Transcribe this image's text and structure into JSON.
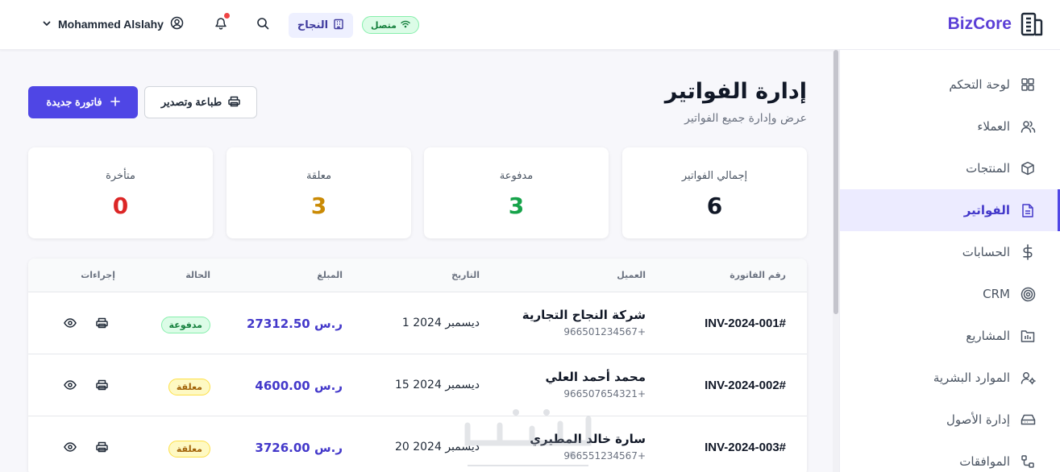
{
  "header": {
    "brand_name": "BizCore",
    "status_label": "متصل",
    "company_label": "النجاح",
    "user_name": "Mohammed Alslahy"
  },
  "sidebar": {
    "items": [
      {
        "label": "لوحة التحكم",
        "icon": "dashboard-icon"
      },
      {
        "label": "العملاء",
        "icon": "users-icon"
      },
      {
        "label": "المنتجات",
        "icon": "box-icon"
      },
      {
        "label": "الفواتير",
        "icon": "invoice-icon",
        "active": true
      },
      {
        "label": "الحسابات",
        "icon": "dollar-icon"
      },
      {
        "label": "CRM",
        "icon": "target-icon"
      },
      {
        "label": "المشاريع",
        "icon": "kanban-icon"
      },
      {
        "label": "الموارد البشرية",
        "icon": "user-cog-icon"
      },
      {
        "label": "إدارة الأصول",
        "icon": "hard-drive-icon"
      },
      {
        "label": "الموافقات",
        "icon": "workflow-icon"
      }
    ]
  },
  "page": {
    "title": "إدارة الفواتير",
    "subtitle": "عرض وإدارة جميع الفواتير",
    "new_invoice_label": "فاتورة جديدة",
    "print_export_label": "طباعة وتصدير"
  },
  "stats": [
    {
      "label": "إجمالي الفواتير",
      "value": "6",
      "color": "#111827"
    },
    {
      "label": "مدفوعة",
      "value": "3",
      "color": "#16a34a"
    },
    {
      "label": "معلقة",
      "value": "3",
      "color": "#ca8a04"
    },
    {
      "label": "متأخرة",
      "value": "0",
      "color": "#dc2626"
    }
  ],
  "table": {
    "headers": {
      "invoice_no": "رقم الفاتورة",
      "client": "العميل",
      "date": "التاريخ",
      "amount": "المبلغ",
      "status": "الحالة",
      "actions": "إجراءات"
    },
    "rows": [
      {
        "invoice_no": "INV-2024-001#",
        "client": "شركة النجاح التجارية",
        "phone": "966501234567+",
        "date": "1 ديسمبر 2024",
        "amount": "27312.50 ر.س",
        "status": "مدفوعة",
        "status_type": "paid"
      },
      {
        "invoice_no": "INV-2024-002#",
        "client": "محمد أحمد العلي",
        "phone": "966507654321+",
        "date": "15 ديسمبر 2024",
        "amount": "4600.00 ر.س",
        "status": "معلقة",
        "status_type": "pending"
      },
      {
        "invoice_no": "INV-2024-003#",
        "client": "سارة خالد المطيري",
        "phone": "966551234567+",
        "date": "20 ديسمبر 2024",
        "amount": "3726.00 ر.س",
        "status": "معلقة",
        "status_type": "pending"
      }
    ]
  },
  "colors": {
    "accent": "#4f46e5",
    "brand": "#5b3fd6",
    "paid": "#15803d",
    "pending": "#a16207"
  }
}
